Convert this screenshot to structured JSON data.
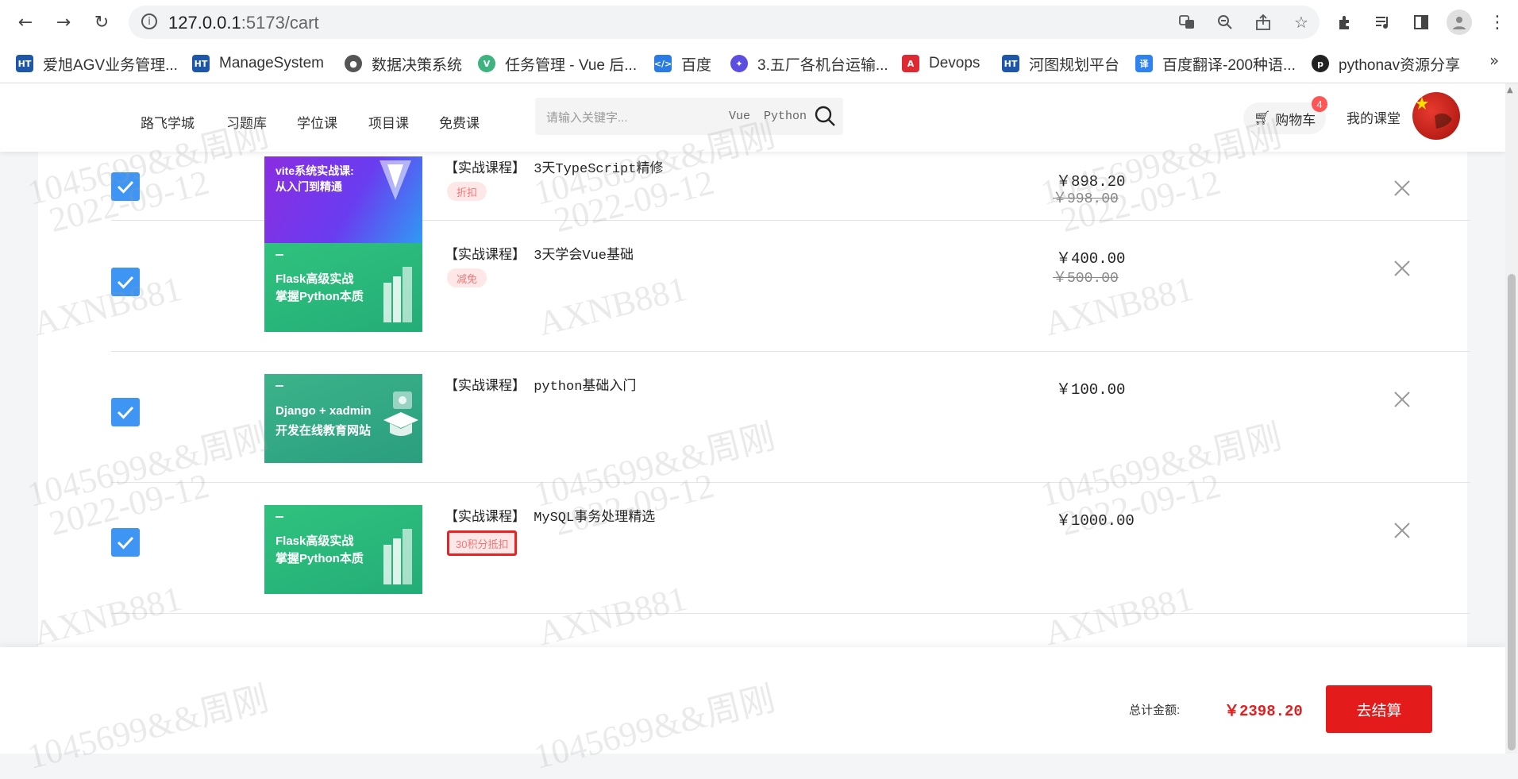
{
  "browser": {
    "url_host": "127.0.0.1",
    "url_path": ":5173/cart",
    "bookmarks": [
      {
        "label": "爱旭AGV业务管理...",
        "icon": "hetu-icon",
        "color": "#1e56a8"
      },
      {
        "label": "ManageSystem",
        "icon": "hetu-icon",
        "color": "#1e56a8"
      },
      {
        "label": "数据决策系统",
        "icon": "globe-icon",
        "color": "#555555"
      },
      {
        "label": "任务管理 - Vue 后...",
        "icon": "vue-icon",
        "color": "#3fb37f"
      },
      {
        "label": "百度",
        "icon": "code-icon",
        "color": "#2a7be4"
      },
      {
        "label": "3.五厂各机台运输...",
        "icon": "bulb-icon",
        "color": "#5b4ee0"
      },
      {
        "label": "Devops",
        "icon": "angular-icon",
        "color": "#dd2a33"
      },
      {
        "label": "河图规划平台",
        "icon": "hetu-icon",
        "color": "#1e56a8"
      },
      {
        "label": "百度翻译-200种语...",
        "icon": "translate-icon",
        "color": "#2e83f0"
      },
      {
        "label": "pythonav资源分享",
        "icon": "python-icon",
        "color": "#222222"
      }
    ],
    "bookmarks_more": "»"
  },
  "header": {
    "menu": [
      "路飞学城",
      "习题库",
      "学位课",
      "项目课",
      "免费课"
    ],
    "search_placeholder": "请输入关键字...",
    "hot_words": [
      "Vue",
      "Python"
    ],
    "cart_label": "购物车",
    "cart_count": "4",
    "my_class": "我的课堂"
  },
  "cart": {
    "items": [
      {
        "title_part1": "vite系统实战课:",
        "title_part2": "从入门到精通",
        "name": "【实战课程】 3天TypeScript精修",
        "tag": "折扣",
        "price": "￥898.20",
        "old_price": "￥998.00",
        "checked": true,
        "theme": "purple"
      },
      {
        "title_part1": "Flask高级实战",
        "title_part2": "掌握Python本质",
        "name": "【实战课程】 3天学会Vue基础",
        "tag": "减免",
        "price": "￥400.00",
        "old_price": "￥500.00",
        "checked": true,
        "theme": "green"
      },
      {
        "title_part1": "Django + xadmin",
        "title_part2": "开发在线教育网站",
        "name": "【实战课程】 python基础入门",
        "tag": "",
        "price": "￥100.00",
        "old_price": "",
        "checked": true,
        "theme": "teal"
      },
      {
        "title_part1": "Flask高级实战",
        "title_part2": "掌握Python本质",
        "name": "【实战课程】 MySQL事务处理精选",
        "tag": "30积分抵扣",
        "price": "￥1000.00",
        "old_price": "",
        "checked": true,
        "theme": "green"
      }
    ]
  },
  "footer": {
    "total_label": "总计金额:",
    "total_value": "￥2398.20",
    "checkout_label": "去结算"
  },
  "watermark": {
    "line1": "1045699&&周刚",
    "line2": "2022-09-12",
    "line3": "AXNB881"
  }
}
